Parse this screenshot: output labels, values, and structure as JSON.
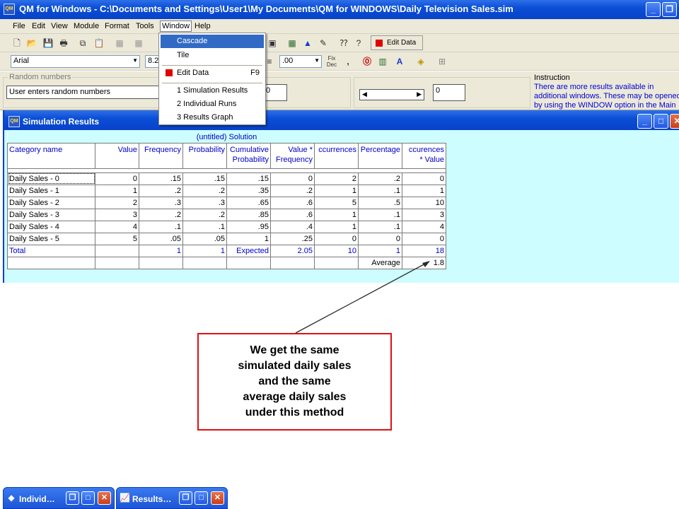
{
  "app": {
    "title": "QM for Windows - C:\\Documents and Settings\\User1\\My Documents\\QM for WINDOWS\\Daily Television Sales.sim",
    "icon_text": "QM"
  },
  "menubar": {
    "items": [
      "File",
      "Edit",
      "View",
      "Module",
      "Format",
      "Tools",
      "Window",
      "Help"
    ]
  },
  "toolbar": {
    "edit_data_label": "Edit Data",
    "font_name": "Arial",
    "font_size": "8.2",
    "decimal_format": ".00",
    "fix_dec_label": "Fix Dec",
    "comma_label": ","
  },
  "window_menu": {
    "items": [
      {
        "label": "Cascade",
        "shortcut": ""
      },
      {
        "label": "Tile",
        "shortcut": ""
      },
      {
        "label": "Edit Data",
        "shortcut": "F9"
      },
      {
        "label": "1 Simulation Results",
        "shortcut": ""
      },
      {
        "label": "2 Individual Runs",
        "shortcut": ""
      },
      {
        "label": "3 Results Graph",
        "shortcut": ""
      }
    ]
  },
  "infobar": {
    "random_numbers_legend": "Random numbers",
    "random_numbers_value": "User enters random numbers",
    "field_value_1": "0",
    "field_value_2": "0",
    "instruction_legend": "Instruction",
    "instruction_text": "There are more results available in additional windows. These may be opened by using the WINDOW option in the Main Menu."
  },
  "sim_window": {
    "title": "Simulation Results",
    "solution_label": "(untitled) Solution",
    "headers": [
      "Category name",
      "Value",
      "Frequency",
      "Probability",
      "Cumulative Probability",
      "Value * Frequency",
      "ccurrences",
      "Percentage",
      "ccurences * Value"
    ],
    "rows": [
      [
        "Daily Sales - 0",
        "0",
        ".15",
        ".15",
        ".15",
        "0",
        "2",
        ".2",
        "0"
      ],
      [
        "Daily Sales - 1",
        "1",
        ".2",
        ".2",
        ".35",
        ".2",
        "1",
        ".1",
        "1"
      ],
      [
        "Daily Sales - 2",
        "2",
        ".3",
        ".3",
        ".65",
        ".6",
        "5",
        ".5",
        "10"
      ],
      [
        "Daily Sales - 3",
        "3",
        ".2",
        ".2",
        ".85",
        ".6",
        "1",
        ".1",
        "3"
      ],
      [
        "Daily Sales - 4",
        "4",
        ".1",
        ".1",
        ".95",
        ".4",
        "1",
        ".1",
        "4"
      ],
      [
        "Daily Sales - 5",
        "5",
        ".05",
        ".05",
        "1",
        ".25",
        "0",
        "0",
        "0"
      ]
    ],
    "total_row": [
      "Total",
      "",
      "1",
      "1",
      "Expected",
      "2.05",
      "10",
      "1",
      "18"
    ],
    "average_row": [
      "",
      "",
      "",
      "",
      "",
      "",
      "",
      "Average",
      "1.8"
    ]
  },
  "callout": {
    "lines": [
      "We get the same",
      "simulated daily sales",
      "and the same",
      "average daily sales",
      "under this method"
    ]
  },
  "taskbar": {
    "windows": [
      {
        "label": "Individ…"
      },
      {
        "label": "Results…"
      }
    ]
  },
  "colors": {
    "title_blue": "#0a4fd6",
    "grid_background": "#cdfdfe",
    "header_text": "#0000c8",
    "callout_border": "#e01010",
    "menu_highlight": "#316ac5"
  }
}
